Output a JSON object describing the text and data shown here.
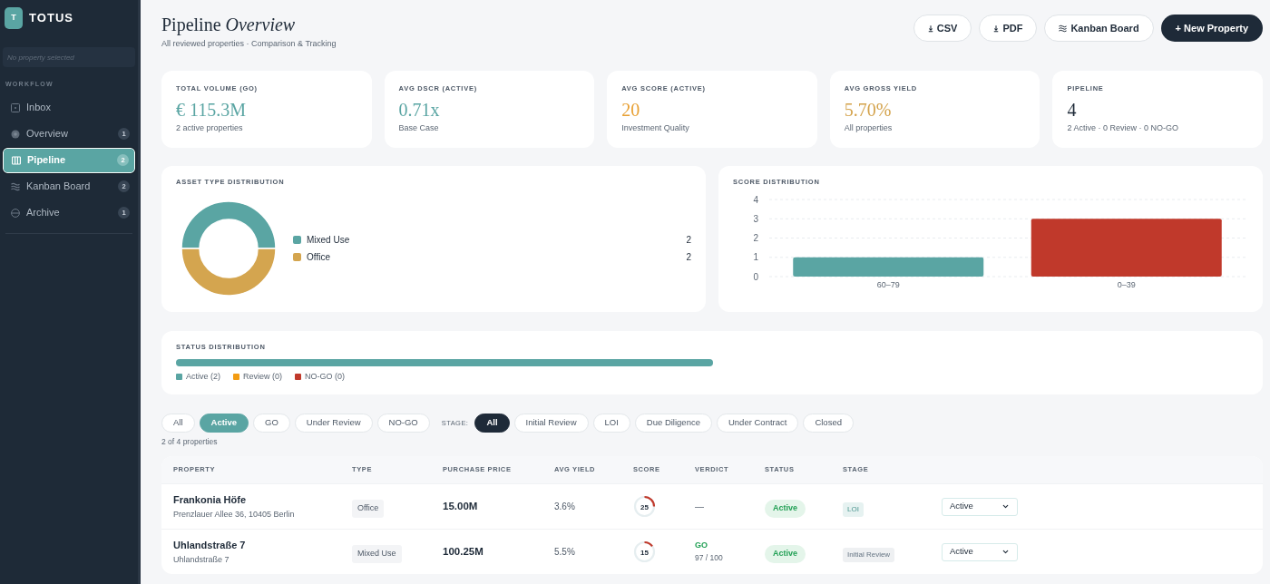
{
  "sidebar": {
    "logo": {
      "letter": "T",
      "name": "TOTUS"
    },
    "property_field": {
      "placeholder": "No property selected"
    },
    "section": "WORKFLOW",
    "items": [
      {
        "label": "Inbox",
        "selected": false
      },
      {
        "label": "Overview",
        "count": "1",
        "selected": false
      },
      {
        "label": "Pipeline",
        "count": "2",
        "selected": true
      },
      {
        "label": "Kanban Board",
        "count": "2",
        "selected": false
      },
      {
        "label": "Archive",
        "count": "1",
        "selected": false
      }
    ]
  },
  "header": {
    "title": "Pipeline *Overview*",
    "subtitle": "All reviewed properties · Comparison & Tracking",
    "buttons": [
      {
        "label": "CSV",
        "kind": "download"
      },
      {
        "label": "PDF",
        "kind": "download"
      },
      {
        "label": "Kanban Board",
        "kind": "kanban"
      },
      {
        "label": "+ New Property",
        "kind": "primary"
      }
    ]
  },
  "stats": [
    {
      "label": "TOTAL VOLUME (GO)",
      "value": "€ 115.3M",
      "note": "2 active properties",
      "color": "#5aa5a3"
    },
    {
      "label": "AVG DSCR (ACTIVE)",
      "value": "0.71x",
      "note": "Base Case",
      "color": "#5aa5a3"
    },
    {
      "label": "AVG SCORE (ACTIVE)",
      "value": "20",
      "note": "Investment Quality",
      "color": "#e8a033"
    },
    {
      "label": "AVG GROSS YIELD",
      "value": "5.70%",
      "note": "All properties",
      "color": "#d4a34c"
    },
    {
      "label": "PIPELINE",
      "value": "4",
      "note": "2 Active · 0 Review · 0 NO-GO",
      "color": "#1e2a38"
    }
  ],
  "asset_types": {
    "title": "ASSET TYPE DISTRIBUTION",
    "chart_data": {
      "type": "donut",
      "categories": [
        "Mixed Use",
        "Office"
      ],
      "values": [
        50,
        50
      ]
    },
    "legend": [
      {
        "count": "2",
        "color": "#5aa5a3"
      },
      {
        "count": "2",
        "color": "#d4a54f"
      }
    ]
  },
  "score_distribution": {
    "title": "SCORE DISTRIBUTION",
    "chart_data": {
      "type": "bar",
      "categories": [
        "60–79",
        "0–39"
      ],
      "series": [
        {
          "color": "#5aa5a3",
          "values": [
            1,
            null
          ]
        },
        {
          "color": "#c0392b",
          "values": [
            null,
            3
          ]
        }
      ],
      "stacked": true,
      "grid": true,
      "ylim": [
        0,
        4
      ],
      "yticks": [
        0,
        1,
        2,
        3,
        4
      ]
    }
  },
  "status": {
    "title": "STATUS DISTRIBUTION",
    "level": 1,
    "legend": [
      {
        "label": "Active (2)",
        "color": "#5aa5a3"
      },
      {
        "label": "Review (0)",
        "color": "#f39c12"
      },
      {
        "label": "NO-GO (0)",
        "color": "#c0392b"
      }
    ]
  },
  "filters": {
    "status": [
      {
        "label": "All",
        "selected": false
      },
      {
        "label": "Active",
        "selected": true
      },
      {
        "label": "GO",
        "selected": false
      },
      {
        "label": "Under Review",
        "selected": false
      },
      {
        "label": "NO-GO",
        "selected": false
      }
    ],
    "stage_label": "STAGE:",
    "stage": [
      {
        "label": "All",
        "selected": true
      },
      {
        "label": "Initial Review",
        "selected": false
      },
      {
        "label": "LOI",
        "selected": false
      },
      {
        "label": "Due Diligence",
        "selected": false
      },
      {
        "label": "Under Contract",
        "selected": false
      },
      {
        "label": "Closed",
        "selected": false
      }
    ],
    "count": "2 of 4 properties"
  },
  "table": {
    "columns": [
      "PROPERTY",
      "TYPE",
      "PURCHASE PRICE",
      "AVG YIELD",
      "SCORE",
      "VERDICT",
      "STATUS",
      "STAGE"
    ],
    "rows": [
      {
        "name": "Frankonia Höfe",
        "address": "Prenzlauer Allee 36, 10405 Berlin",
        "asset_type": "Office",
        "price": "15.00M",
        "yield": "3.6%",
        "score": "25",
        "verdict": {
          "kind": "none",
          "label": "—"
        },
        "status": "Active",
        "stage": {
          "label": "LOI",
          "color": "#e6f2f1"
        },
        "select": "Active"
      },
      {
        "name": "Uhlandstraße 7",
        "address": "Uhlandstraße 7",
        "asset_type": "Mixed Use",
        "price": "100.25M",
        "yield": "5.5%",
        "score": "15",
        "verdict": {
          "kind": "go",
          "label": "GO",
          "detail": "97 / 100"
        },
        "status": "Active",
        "stage": {
          "label": "Initial Review",
          "color": "#eef0f2"
        },
        "select": "Active"
      }
    ]
  }
}
